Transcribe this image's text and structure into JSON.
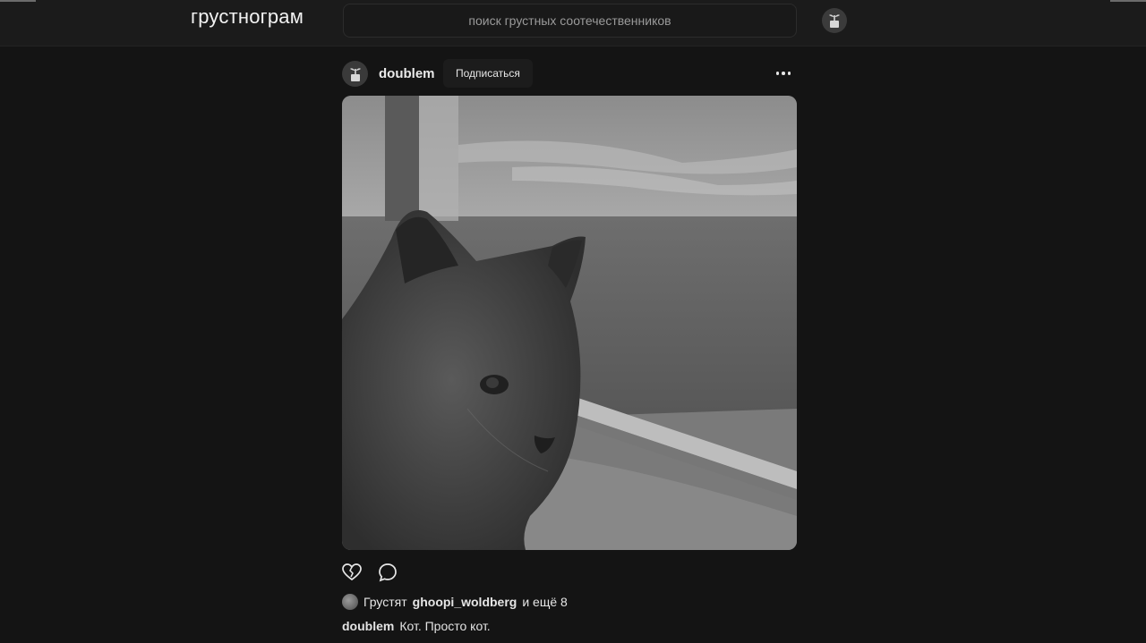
{
  "header": {
    "logo": "грустнограм",
    "search_placeholder": "поиск грустных соотечественников",
    "profile_icon": "plant-pot-icon"
  },
  "post": {
    "username": "doublem",
    "subscribe_label": "Подписаться",
    "more_icon": "more-dots-icon",
    "image_alt": "black-and-white photo of a gray cat sitting by a railing with the sea behind",
    "actions": {
      "like_icon": "broken-heart-icon",
      "comment_icon": "comment-bubble-icon"
    },
    "likes": {
      "prefix": "Грустят",
      "user": "ghoopi_woldberg",
      "suffix": "и ещё 8"
    },
    "caption": {
      "author": "doublem",
      "text": "Кот. Просто кот."
    }
  }
}
